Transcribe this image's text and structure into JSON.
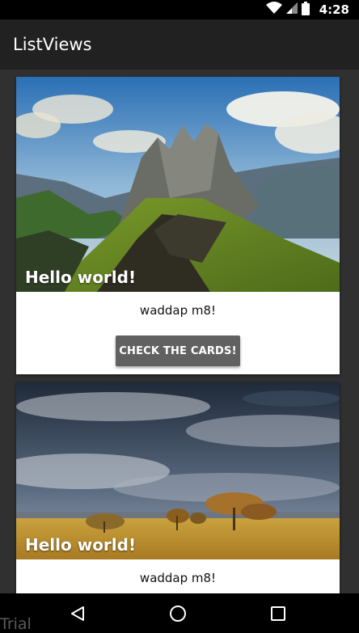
{
  "status_bar": {
    "time": "4:28",
    "icons": [
      "wifi-icon",
      "signal-icon",
      "battery-icon"
    ]
  },
  "app_bar": {
    "title": "ListViews"
  },
  "cards": [
    {
      "title": "Hello world!",
      "text": "waddap m8!",
      "button_label": "CHECK THE CARDS!",
      "image": "mountain-landscape"
    },
    {
      "title": "Hello world!",
      "text": "waddap m8!",
      "image": "savanna-landscape"
    }
  ],
  "nav_bar": {
    "icons": [
      "back-icon",
      "home-icon",
      "recents-icon"
    ],
    "watermark": "Trial"
  },
  "colors": {
    "app_bar": "#212121",
    "background": "#303030",
    "button": "#616161"
  }
}
